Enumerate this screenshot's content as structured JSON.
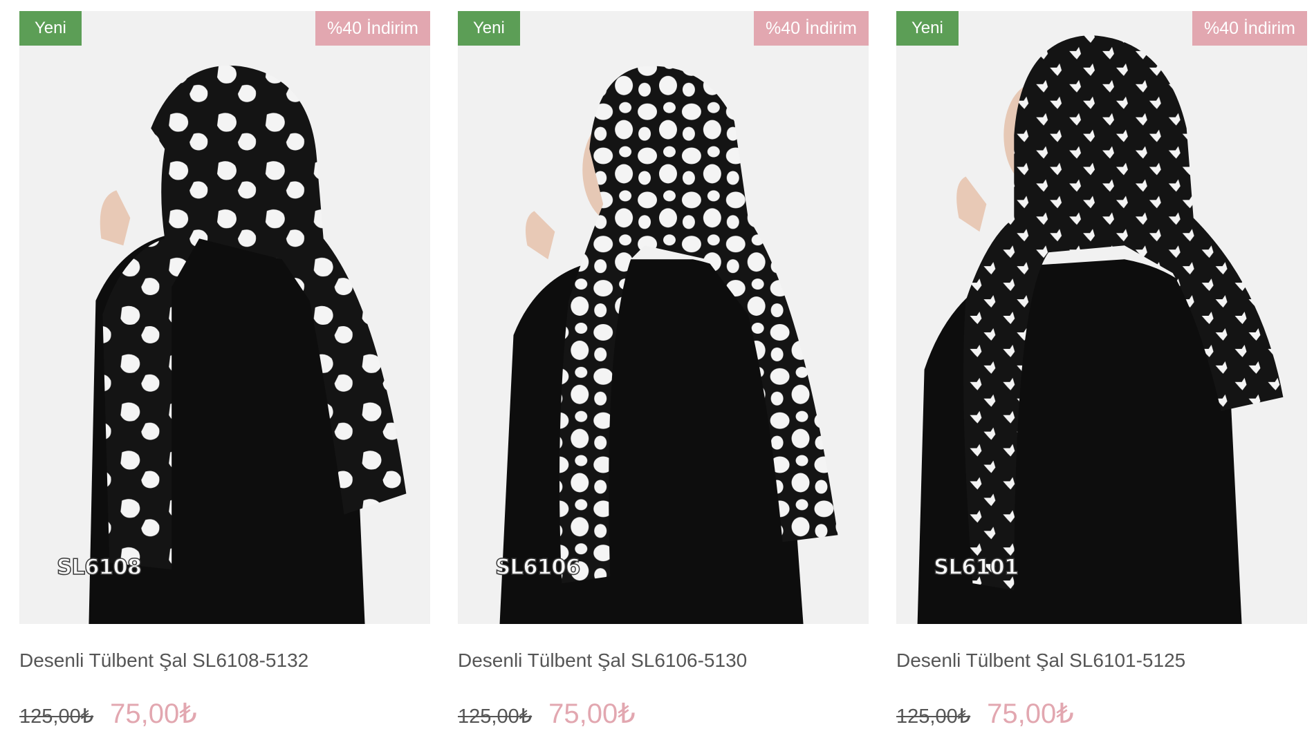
{
  "products": [
    {
      "badge_new": "Yeni",
      "badge_discount": "%40 İndirim",
      "image_code": "SL6108",
      "title": "Desenli Tülbent Şal SL6108-5132",
      "old_price": "125,00₺",
      "new_price": "75,00₺",
      "pattern": "brush-spots"
    },
    {
      "badge_new": "Yeni",
      "badge_discount": "%40 İndirim",
      "image_code": "SL6106",
      "title": "Desenli Tülbent Şal SL6106-5130",
      "old_price": "125,00₺",
      "new_price": "75,00₺",
      "pattern": "giraffe-cells"
    },
    {
      "badge_new": "Yeni",
      "badge_discount": "%40 İndirim",
      "image_code": "SL6101",
      "title": "Desenli Tülbent Şal SL6101-5125",
      "old_price": "125,00₺",
      "new_price": "75,00₺",
      "pattern": "houndstooth"
    }
  ],
  "colors": {
    "badge_new": "#5c9e56",
    "badge_discount": "#e2a7b0",
    "sale_price": "#e2a7b0",
    "text": "#555555",
    "image_background": "#f1f1f1"
  }
}
